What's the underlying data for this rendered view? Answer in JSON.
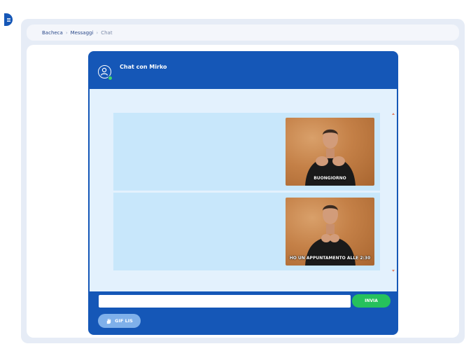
{
  "breadcrumb": {
    "items": [
      "Bacheca",
      "Messaggi",
      "Chat"
    ]
  },
  "chat": {
    "title": "Chat con Mirko",
    "status_color": "#3fd36a",
    "messages": [
      {
        "caption": "BUONGIORNO"
      },
      {
        "caption": "HO UN APPUNTAMENTO ALLE 2:30"
      }
    ]
  },
  "composer": {
    "input_value": "",
    "send_label": "INVIA",
    "gif_label": "GIF LIS"
  },
  "colors": {
    "accent": "#1557b7",
    "send": "#26c15c",
    "gif": "#7fb0ea"
  }
}
